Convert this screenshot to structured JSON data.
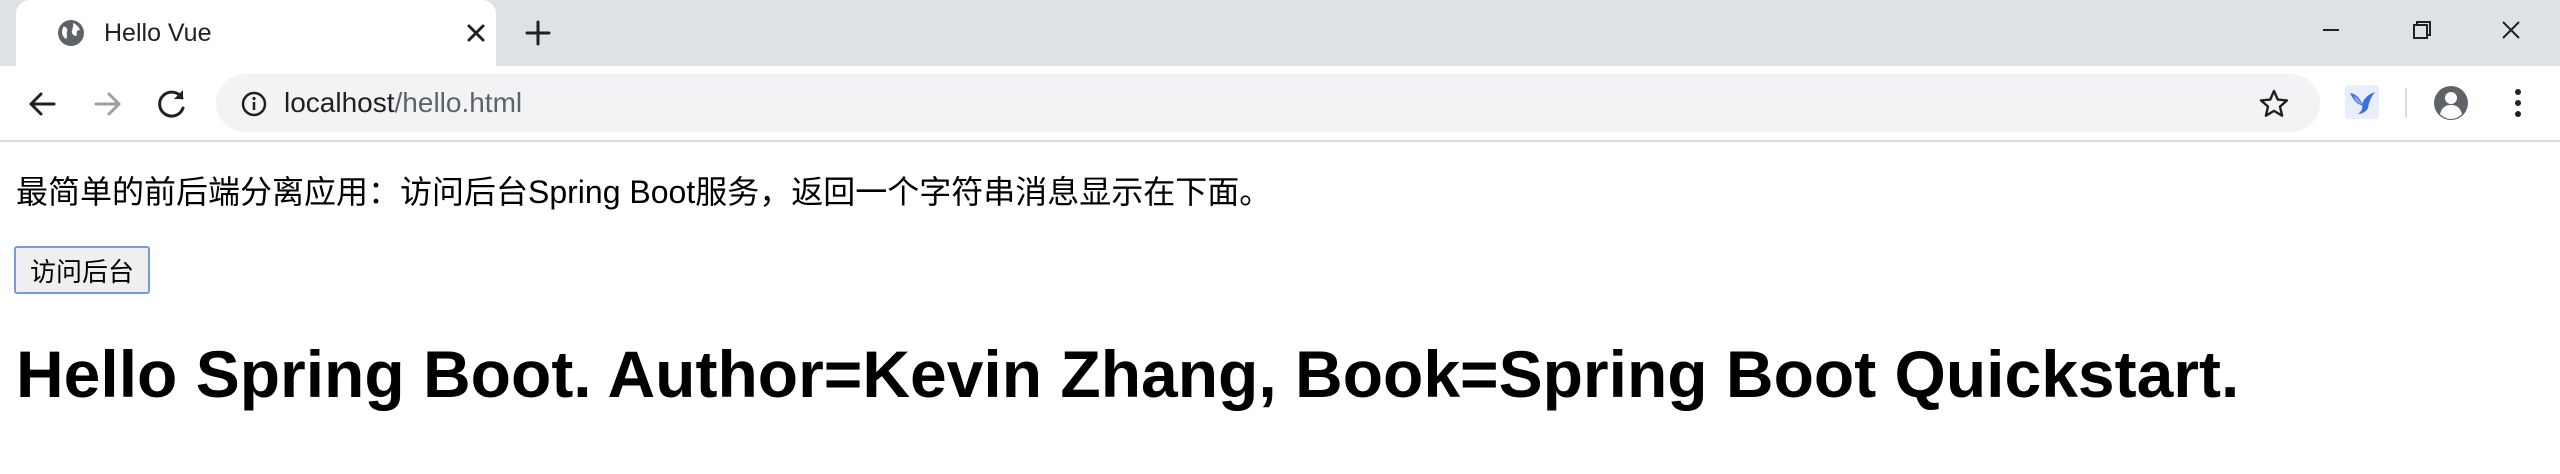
{
  "tab": {
    "title": "Hello Vue",
    "favicon": "globe-icon"
  },
  "address_bar": {
    "host": "localhost",
    "path": "/hello.html"
  },
  "page": {
    "intro": "最简单的前后端分离应用：访问后台Spring Boot服务，返回一个字符串消息显示在下面。",
    "button_label": "访问后台",
    "message": "Hello Spring Boot. Author=Kevin Zhang, Book=Spring Boot Quickstart."
  },
  "colors": {
    "tabstrip": "#dee1e6",
    "omnibox": "#f1f3f4",
    "button_border": "#7a9cd3"
  }
}
